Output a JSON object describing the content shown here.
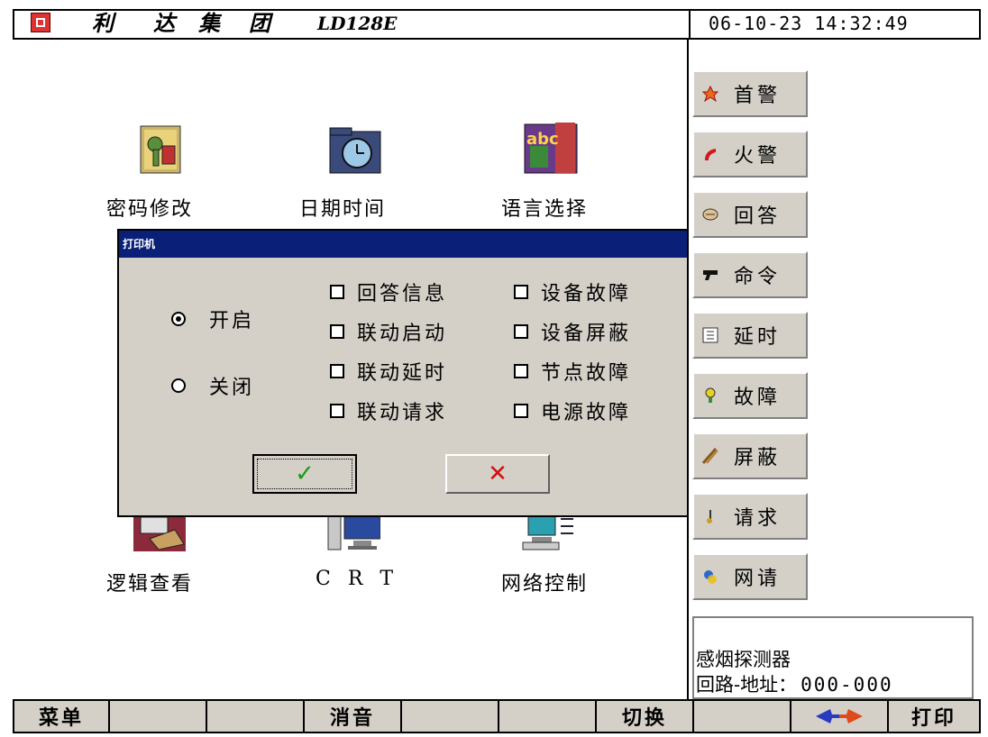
{
  "header": {
    "brand_chars": [
      "利",
      "达",
      "集",
      "团"
    ],
    "model": "LD128E",
    "datetime": "06-10-23 14:32:49"
  },
  "main": {
    "icons": [
      {
        "label": "密码修改",
        "icon": "password-icon"
      },
      {
        "label": "日期时间",
        "icon": "clock-icon"
      },
      {
        "label": "语言选择",
        "icon": "language-icon"
      },
      {
        "label": "逻辑查看",
        "icon": "logic-icon"
      },
      {
        "label": "C R T",
        "icon": "crt-icon"
      },
      {
        "label": "网络控制",
        "icon": "network-icon"
      }
    ]
  },
  "dialog": {
    "title": "打印机",
    "radios": [
      {
        "label": "开启",
        "checked": true
      },
      {
        "label": "关闭",
        "checked": false
      }
    ],
    "checkboxes_col1": [
      "回答信息",
      "联动启动",
      "联动延时",
      "联动请求"
    ],
    "checkboxes_col2": [
      "设备故障",
      "设备屏蔽",
      "节点故障",
      "电源故障"
    ],
    "ok_symbol": "✓",
    "cancel_symbol": "✕"
  },
  "sidebar": {
    "buttons": [
      {
        "label": "首警",
        "icon": "first-alarm-icon"
      },
      {
        "label": "火警",
        "icon": "fire-alarm-icon"
      },
      {
        "label": "回答",
        "icon": "answer-icon"
      },
      {
        "label": "命令",
        "icon": "command-icon"
      },
      {
        "label": "延时",
        "icon": "delay-icon"
      },
      {
        "label": "故障",
        "icon": "fault-icon"
      },
      {
        "label": "屏蔽",
        "icon": "shield-icon"
      },
      {
        "label": "请求",
        "icon": "request-icon"
      },
      {
        "label": "网请",
        "icon": "network-request-icon"
      }
    ]
  },
  "info": {
    "device": "感烟探测器",
    "addr_label": "回路-地址：",
    "addr_value": "000-000"
  },
  "bottombar": {
    "menu": "菜单",
    "mute": "消音",
    "switch": "切换",
    "print": "打印"
  },
  "colors": {
    "dialog_title_bg": "#0a1f78",
    "button_face": "#d4d0c8",
    "ok_green": "#1a9a1a",
    "cancel_red": "#d01010"
  }
}
